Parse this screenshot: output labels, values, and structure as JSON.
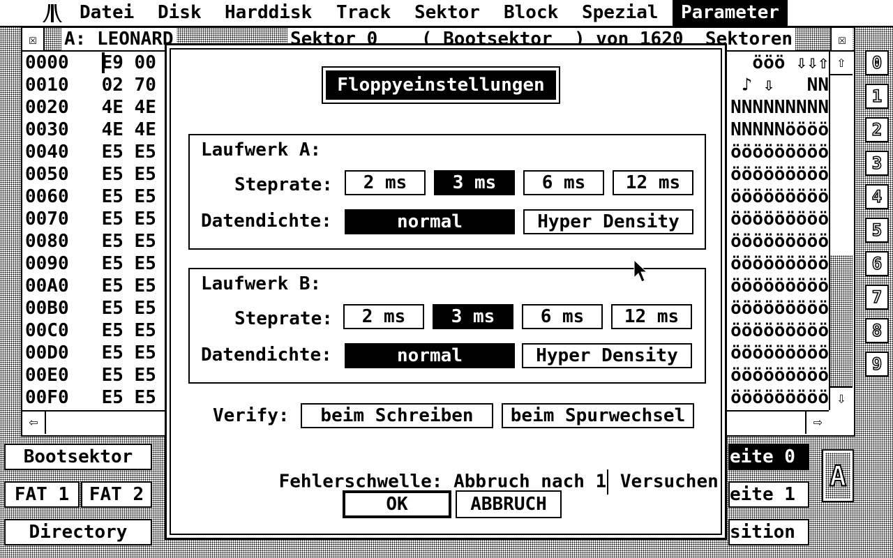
{
  "menubar": {
    "logo": "atari-logo-icon",
    "items": [
      "Datei",
      "Disk",
      "Harddisk",
      "Track",
      "Sektor",
      "Block",
      "Spezial",
      "Parameter"
    ],
    "active": "Parameter"
  },
  "editor": {
    "drive_label": "A: LEONARD",
    "sector_title": "Sektor 0    ( Bootsektor  ) von 1620  Sektoren",
    "rows": [
      {
        "addr": "0000",
        "hex": "E9 00",
        "ascii": "ööö ⇩⇩⇧"
      },
      {
        "addr": "0010",
        "hex": "02 70",
        "ascii": "♪ ⇩   NN"
      },
      {
        "addr": "0020",
        "hex": "4E 4E",
        "ascii": "NNNNNNNNN"
      },
      {
        "addr": "0030",
        "hex": "4E 4E",
        "ascii": "NNNNNöööö"
      },
      {
        "addr": "0040",
        "hex": "E5 E5",
        "ascii": "ööööööööö"
      },
      {
        "addr": "0050",
        "hex": "E5 E5",
        "ascii": "ööööööööö"
      },
      {
        "addr": "0060",
        "hex": "E5 E5",
        "ascii": "ööööööööö"
      },
      {
        "addr": "0070",
        "hex": "E5 E5",
        "ascii": "ööööööööö"
      },
      {
        "addr": "0080",
        "hex": "E5 E5",
        "ascii": "ööööööööö"
      },
      {
        "addr": "0090",
        "hex": "E5 E5",
        "ascii": "ööööööööö"
      },
      {
        "addr": "00A0",
        "hex": "E5 E5",
        "ascii": "ööööööööö"
      },
      {
        "addr": "00B0",
        "hex": "E5 E5",
        "ascii": "ööööööööö"
      },
      {
        "addr": "00C0",
        "hex": "E5 E5",
        "ascii": "ööööööööö"
      },
      {
        "addr": "00D0",
        "hex": "E5 E5",
        "ascii": "ööööööööö"
      },
      {
        "addr": "00E0",
        "hex": "E5 E5",
        "ascii": "ööööööööö"
      },
      {
        "addr": "00F0",
        "hex": "E5 E5",
        "ascii": "ööööööööö"
      }
    ],
    "scroll_up": "⇧",
    "scroll_down": "⇩",
    "scroll_left": "⇦",
    "scroll_right": "⇨",
    "close_icon": "close-box-icon"
  },
  "digits": [
    "0",
    "1",
    "2",
    "3",
    "4",
    "5",
    "6",
    "7",
    "8",
    "9"
  ],
  "bottom": {
    "bootsektor": "Bootsektor",
    "fat1": "FAT 1",
    "fat2": "FAT 2",
    "directory": "Directory",
    "seite0": "eite 0",
    "seite1": "eite 1",
    "position": "sition",
    "drive_letter": "A"
  },
  "dialog": {
    "title": "Floppyeinstellungen",
    "drive_a": {
      "label": "Laufwerk A:",
      "steprate_label": "Steprate:",
      "steprates": [
        "2 ms",
        "3 ms",
        "6 ms",
        "12 ms"
      ],
      "steprate_selected": "3 ms",
      "density_label": "Datendichte:",
      "density_normal": "normal",
      "density_hyper": "Hyper Density",
      "density_selected": "normal"
    },
    "drive_b": {
      "label": "Laufwerk B:",
      "steprate_label": "Steprate:",
      "steprates": [
        "2 ms",
        "3 ms",
        "6 ms",
        "12 ms"
      ],
      "steprate_selected": "3 ms",
      "density_label": "Datendichte:",
      "density_normal": "normal",
      "density_hyper": "Hyper Density",
      "density_selected": "normal"
    },
    "verify_label": "Verify:",
    "verify_write": "beim Schreiben",
    "verify_track": "beim Spurwechsel",
    "threshold_prefix": "Fehlerschwelle: Abbruch nach ",
    "threshold_value": "1",
    "threshold_suffix": " Versuchen",
    "ok": "OK",
    "cancel": "ABBRUCH"
  }
}
